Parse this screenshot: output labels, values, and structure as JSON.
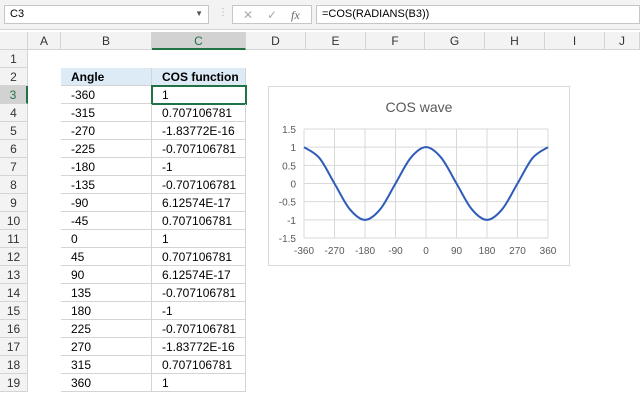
{
  "name_box": "C3",
  "formula": "=COS(RADIANS(B3))",
  "columns": [
    "A",
    "B",
    "C",
    "D",
    "E",
    "F",
    "G",
    "H",
    "I",
    "J"
  ],
  "rows": [
    "1",
    "2",
    "3",
    "4",
    "5",
    "6",
    "7",
    "8",
    "9",
    "10",
    "11",
    "12",
    "13",
    "14",
    "15",
    "16",
    "17",
    "18",
    "19"
  ],
  "table": {
    "headers": [
      "Angle",
      "COS function"
    ],
    "data": [
      [
        "-360",
        "1"
      ],
      [
        "-315",
        "0.707106781"
      ],
      [
        "-270",
        "-1.83772E-16"
      ],
      [
        "-225",
        "-0.707106781"
      ],
      [
        "-180",
        "-1"
      ],
      [
        "-135",
        "-0.707106781"
      ],
      [
        "-90",
        "6.12574E-17"
      ],
      [
        "-45",
        "0.707106781"
      ],
      [
        "0",
        "1"
      ],
      [
        "45",
        "0.707106781"
      ],
      [
        "90",
        "6.12574E-17"
      ],
      [
        "135",
        "-0.707106781"
      ],
      [
        "180",
        "-1"
      ],
      [
        "225",
        "-0.707106781"
      ],
      [
        "270",
        "-1.83772E-16"
      ],
      [
        "315",
        "0.707106781"
      ],
      [
        "360",
        "1"
      ]
    ]
  },
  "chart_data": {
    "type": "line",
    "title": "COS wave",
    "x": [
      -360,
      -315,
      -270,
      -225,
      -180,
      -135,
      -90,
      -45,
      0,
      45,
      90,
      135,
      180,
      225,
      270,
      315,
      360
    ],
    "y": [
      1,
      0.707,
      0,
      -0.707,
      -1,
      -0.707,
      0,
      0.707,
      1,
      0.707,
      0,
      -0.707,
      -1,
      -0.707,
      0,
      0.707,
      1
    ],
    "xticks": [
      "-360",
      "-270",
      "-180",
      "-90",
      "0",
      "90",
      "180",
      "270",
      "360"
    ],
    "yticks": [
      "1.5",
      "1",
      "0.5",
      "0",
      "-0.5",
      "-1",
      "-1.5"
    ],
    "xlim": [
      -360,
      360
    ],
    "ylim": [
      -1.5,
      1.5
    ],
    "grid": true,
    "color": "#2e5cb8"
  }
}
